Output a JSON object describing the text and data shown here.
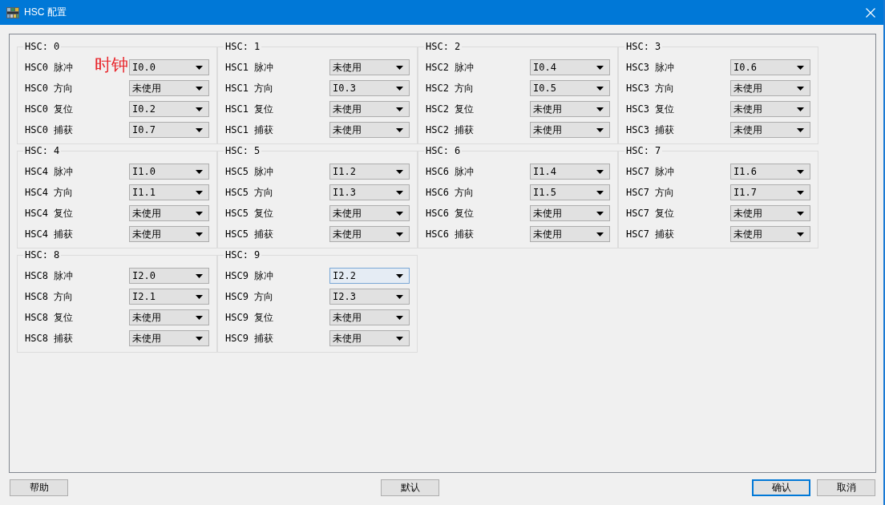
{
  "window": {
    "title": "HSC 配置"
  },
  "annotation": {
    "text": "时钟"
  },
  "groups": [
    {
      "title": "HSC: 0",
      "rows": [
        {
          "label": "HSC0 脉冲",
          "value": "I0.0",
          "focused": false
        },
        {
          "label": "HSC0 方向",
          "value": "未使用",
          "focused": false
        },
        {
          "label": "HSC0 复位",
          "value": "I0.2",
          "focused": false
        },
        {
          "label": "HSC0 捕获",
          "value": "I0.7",
          "focused": false
        }
      ]
    },
    {
      "title": "HSC: 1",
      "rows": [
        {
          "label": "HSC1 脉冲",
          "value": "未使用",
          "focused": false
        },
        {
          "label": "HSC1 方向",
          "value": "I0.3",
          "focused": false
        },
        {
          "label": "HSC1 复位",
          "value": "未使用",
          "focused": false
        },
        {
          "label": "HSC1 捕获",
          "value": "未使用",
          "focused": false
        }
      ]
    },
    {
      "title": "HSC: 2",
      "rows": [
        {
          "label": "HSC2 脉冲",
          "value": "I0.4",
          "focused": false
        },
        {
          "label": "HSC2 方向",
          "value": "I0.5",
          "focused": false
        },
        {
          "label": "HSC2 复位",
          "value": "未使用",
          "focused": false
        },
        {
          "label": "HSC2 捕获",
          "value": "未使用",
          "focused": false
        }
      ]
    },
    {
      "title": "HSC: 3",
      "rows": [
        {
          "label": "HSC3 脉冲",
          "value": "I0.6",
          "focused": false
        },
        {
          "label": "HSC3 方向",
          "value": "未使用",
          "focused": false
        },
        {
          "label": "HSC3 复位",
          "value": "未使用",
          "focused": false
        },
        {
          "label": "HSC3 捕获",
          "value": "未使用",
          "focused": false
        }
      ]
    },
    {
      "title": "HSC: 4",
      "rows": [
        {
          "label": "HSC4 脉冲",
          "value": "I1.0",
          "focused": false
        },
        {
          "label": "HSC4 方向",
          "value": "I1.1",
          "focused": false
        },
        {
          "label": "HSC4 复位",
          "value": "未使用",
          "focused": false
        },
        {
          "label": "HSC4 捕获",
          "value": "未使用",
          "focused": false
        }
      ]
    },
    {
      "title": "HSC: 5",
      "rows": [
        {
          "label": "HSC5 脉冲",
          "value": "I1.2",
          "focused": false
        },
        {
          "label": "HSC5 方向",
          "value": "I1.3",
          "focused": false
        },
        {
          "label": "HSC5 复位",
          "value": "未使用",
          "focused": false
        },
        {
          "label": "HSC5 捕获",
          "value": "未使用",
          "focused": false
        }
      ]
    },
    {
      "title": "HSC: 6",
      "rows": [
        {
          "label": "HSC6 脉冲",
          "value": "I1.4",
          "focused": false
        },
        {
          "label": "HSC6 方向",
          "value": "I1.5",
          "focused": false
        },
        {
          "label": "HSC6 复位",
          "value": "未使用",
          "focused": false
        },
        {
          "label": "HSC6 捕获",
          "value": "未使用",
          "focused": false
        }
      ]
    },
    {
      "title": "HSC: 7",
      "rows": [
        {
          "label": "HSC7 脉冲",
          "value": "I1.6",
          "focused": false
        },
        {
          "label": "HSC7 方向",
          "value": "I1.7",
          "focused": false
        },
        {
          "label": "HSC7 复位",
          "value": "未使用",
          "focused": false
        },
        {
          "label": "HSC7 捕获",
          "value": "未使用",
          "focused": false
        }
      ]
    },
    {
      "title": "HSC: 8",
      "rows": [
        {
          "label": "HSC8 脉冲",
          "value": "I2.0",
          "focused": false
        },
        {
          "label": "HSC8 方向",
          "value": "I2.1",
          "focused": false
        },
        {
          "label": "HSC8 复位",
          "value": "未使用",
          "focused": false
        },
        {
          "label": "HSC8 捕获",
          "value": "未使用",
          "focused": false
        }
      ]
    },
    {
      "title": "HSC: 9",
      "rows": [
        {
          "label": "HSC9 脉冲",
          "value": "I2.2",
          "focused": true
        },
        {
          "label": "HSC9 方向",
          "value": "I2.3",
          "focused": false
        },
        {
          "label": "HSC9 复位",
          "value": "未使用",
          "focused": false
        },
        {
          "label": "HSC9 捕获",
          "value": "未使用",
          "focused": false
        }
      ]
    }
  ],
  "buttons": [
    {
      "label": "帮助",
      "default": false
    },
    {
      "label": "默认",
      "default": false
    },
    {
      "label": "确认",
      "default": true
    },
    {
      "label": "取消",
      "default": false
    }
  ]
}
